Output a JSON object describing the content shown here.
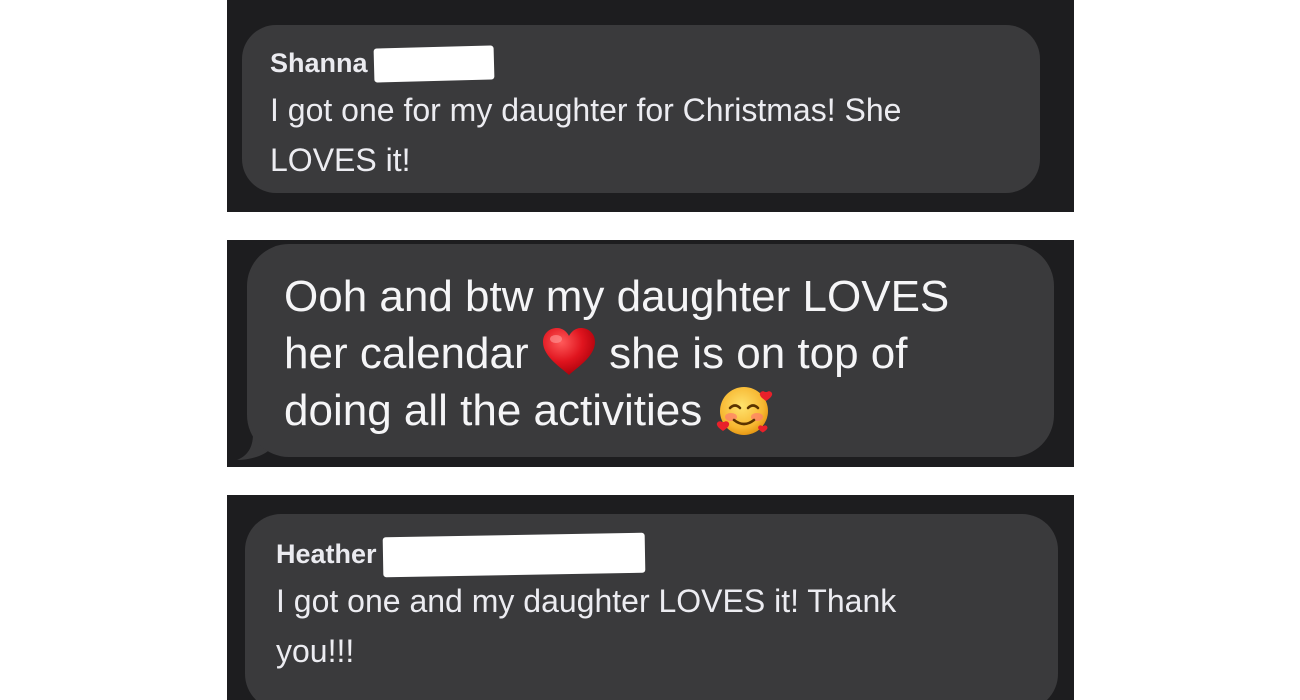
{
  "messages": [
    {
      "sender": "Shanna",
      "text": "I got one for my daughter for Christmas! She\nLOVES it!"
    },
    {
      "line1": "Ooh and btw my daughter LOVES",
      "line2_before": "her calendar",
      "emoji_1": "red-heart",
      "line2_after": "she is on top of",
      "line3": "doing all the activities",
      "emoji_2": "smiling-face-with-hearts"
    },
    {
      "sender": "Heather",
      "text": "I got one and my daughter LOVES it! Thank\nyou!!!"
    }
  ],
  "colors": {
    "background": "#ffffff",
    "panel": "#1d1d1f",
    "bubble": "#3a3a3c",
    "text": "#f2f2f7",
    "redaction": "#ffffff"
  }
}
